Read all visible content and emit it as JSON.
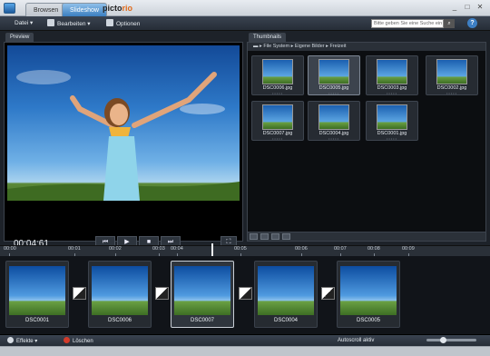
{
  "tabs": [
    {
      "label": "Browsen"
    },
    {
      "label": "Slideshow"
    }
  ],
  "brand": {
    "name": "picto",
    "suffix": "rio"
  },
  "window": {
    "minimize": "_",
    "maximize": "□",
    "close": "✕"
  },
  "toolbar": {
    "datei": "Datei",
    "bearbeiten": "Bearbeiten",
    "optionen": "Optionen",
    "search_placeholder": "Bitte geben Sie eine Suche ein",
    "help": "?"
  },
  "preview": {
    "tab": "Preview",
    "timecode": "00:04:61",
    "controls": {
      "prev": "⏮",
      "play": "▶",
      "stop": "■",
      "next": "⏭",
      "fullscreen": "⛶"
    }
  },
  "thumbnails": {
    "tab": "Thumbnails",
    "breadcrumb": [
      "File System",
      "Eigene Bilder",
      "Freizeit"
    ],
    "items": [
      {
        "name": "DSC0006.jpg"
      },
      {
        "name": "DSC0005.jpg"
      },
      {
        "name": "DSC0003.jpg"
      },
      {
        "name": "DSC0002.jpg"
      },
      {
        "name": "DSC0007.jpg"
      },
      {
        "name": "DSC0004.jpg"
      },
      {
        "name": "DSC0001.jpg"
      }
    ]
  },
  "timeline": {
    "ticks": [
      "00:00",
      "00:01",
      "00:02",
      "00:03",
      "00:04",
      "00:05",
      "00:06",
      "00:07",
      "00:08",
      "00:09"
    ],
    "clips": [
      {
        "name": "DSC0001"
      },
      {
        "name": "DSC0006"
      },
      {
        "name": "DSC0007"
      },
      {
        "name": "DSC0004"
      },
      {
        "name": "DSC0005"
      }
    ]
  },
  "bottombar": {
    "effekte": "Effekte",
    "loeschen": "Löschen",
    "autoscroll": "Autoscroll aktiv"
  },
  "colors": {
    "accent": "#3b7fbf",
    "brand_orange": "#e06a1a",
    "delete_red": "#d23a2a"
  }
}
